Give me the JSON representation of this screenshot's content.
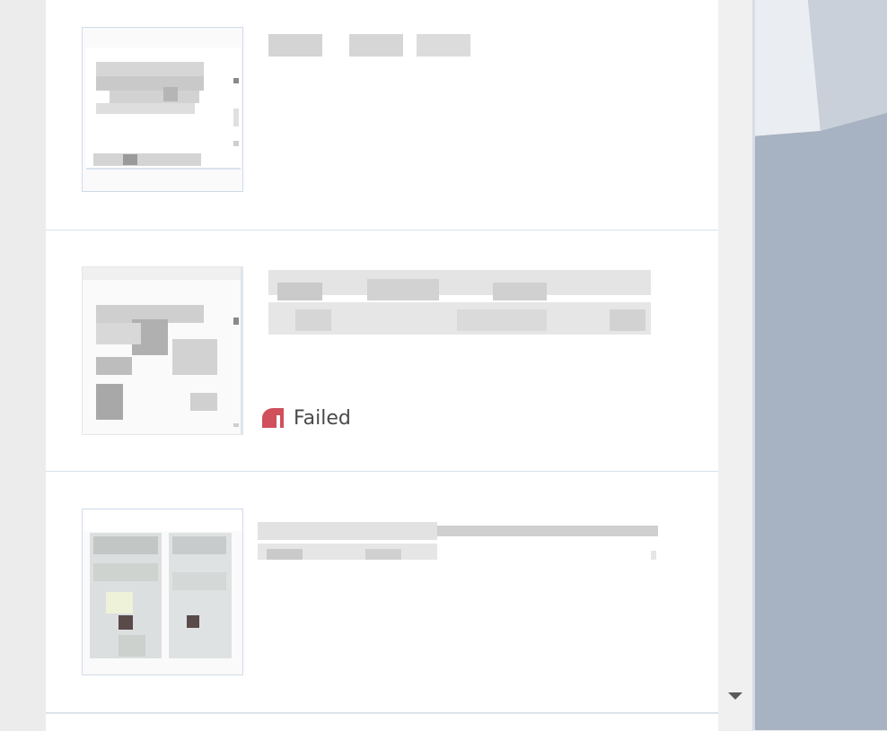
{
  "items": [
    {
      "title": "",
      "status": ""
    },
    {
      "title": "",
      "status": "Failed"
    },
    {
      "title": "",
      "status": ""
    }
  ],
  "colors": {
    "failed_accent": "#d0505c",
    "divider": "#d6e2ee",
    "scroll_arrow": "#5a5a5a"
  },
  "icons": {
    "status_failed": "failed-status-icon",
    "scroll_down": "triangle-down-icon"
  }
}
